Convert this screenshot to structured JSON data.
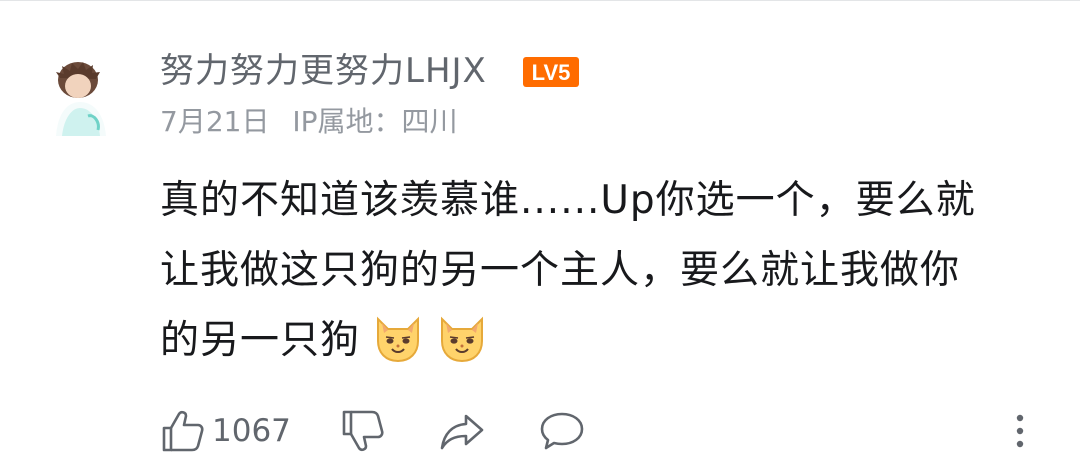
{
  "comment": {
    "username": "努力努力更努力LHJX",
    "level_badge": "LV5",
    "date": "7月21日",
    "ip_location": "IP属地：四川",
    "content_lines": [
      "真的不知道该羡慕谁......Up你选一个，要么就",
      "让我做这只狗的另一个主人，要么就让我做你",
      "的另一只狗"
    ],
    "emojis": [
      "cat-face-emoji",
      "cat-face-emoji"
    ],
    "like_count": "1067"
  },
  "icons": {
    "avatar": "user-avatar",
    "like": "thumbs-up-icon",
    "dislike": "thumbs-down-icon",
    "share": "share-arrow-icon",
    "reply": "speech-bubble-icon",
    "more": "more-vertical-icon"
  },
  "colors": {
    "username": "#61666d",
    "meta": "#9499a0",
    "content": "#18191c",
    "level_badge": "#ff6c00",
    "emoji_fill": "#ffd36b"
  }
}
